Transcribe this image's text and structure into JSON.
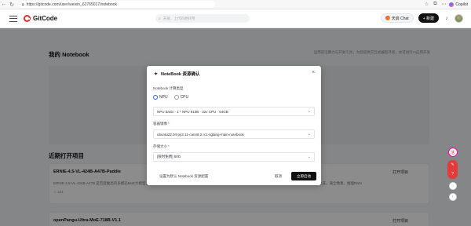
{
  "browser": {
    "url": "https://gitcode.com/user/weixin_62765017/notebook",
    "copilot_label": "Copilot"
  },
  "header": {
    "logo_text": "GitCode",
    "search_placeholder": "开发，上代码更好用",
    "chat_label": "天启 Chat",
    "new_label": "+ 新建"
  },
  "page": {
    "notebook_title": "我的 Notebook",
    "notebook_desc": "运用前沿算力与开发工具，为您提供交互式编程环境，亦可进行AI应用开发",
    "recent_title": "近期打开项目",
    "projects": [
      {
        "name": "ERNIE-4.5-VL-424B-A47B-Paddle",
        "desc": "ERNIE-4.5-VL-424B-A47B 是百度推出的多模态MoE大模型，支持图像与文本输入，可理解复杂视觉信息，适用于图文问答、图片描述等与场景理解，提供智能推理的图文生成，满全像素、推理RNN",
        "stars": "☆ 121",
        "open_label": "打开项目"
      },
      {
        "name": "openPangu-Ultra-MoE-718B-V1.1",
        "open_label": "打开项目"
      }
    ]
  },
  "modal": {
    "title": "NoteBook 资源确认",
    "type_label": "Notebook 计算类型",
    "type_options": [
      "NPU",
      "CPU"
    ],
    "type_selected": "NPU",
    "spec_value": "NPU basic · 1 * NPU 910B · 32v CPU · 64GB",
    "image_label": "容器镜像",
    "image_value": "ubuntu22.04-py3.11-cann8.2.rc1-sglang-main-notebook",
    "storage_label": "存储大小",
    "storage_value": "[限时免费] 50G",
    "default_link": "设置为默认 Notebook 资源配置",
    "cancel_label": "取消",
    "start_label": "立即启动",
    "required_mark": "*"
  },
  "float_bar": {
    "badge": "活"
  }
}
